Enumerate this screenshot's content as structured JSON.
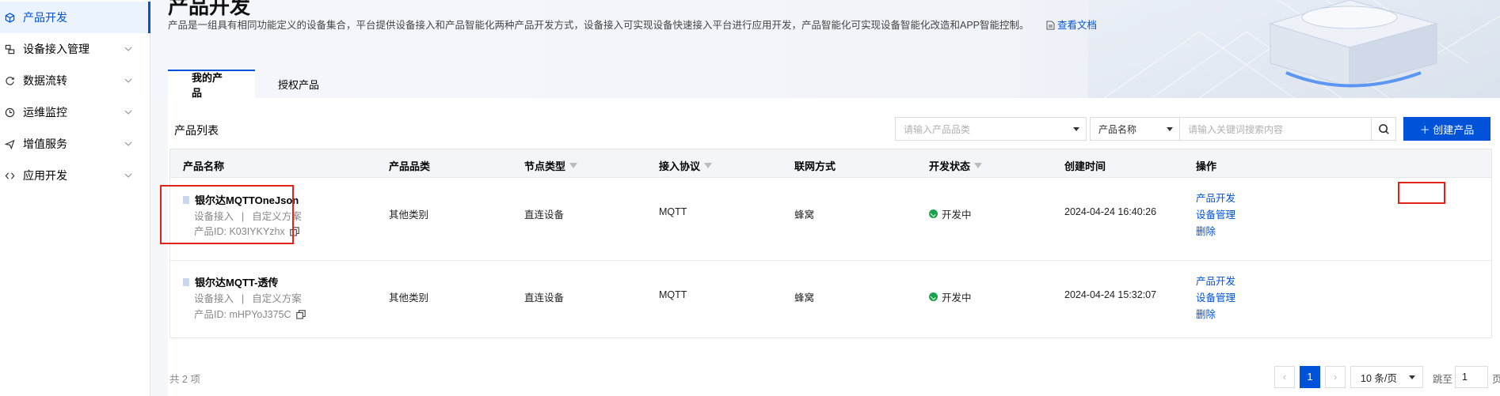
{
  "sidebar": {
    "items": [
      {
        "label": "产品开发",
        "icon": "cube-icon",
        "active": true
      },
      {
        "label": "设备接入管理",
        "icon": "device-icon"
      },
      {
        "label": "数据流转",
        "icon": "dataflow-icon"
      },
      {
        "label": "运维监控",
        "icon": "monitor-icon"
      },
      {
        "label": "增值服务",
        "icon": "send-icon"
      },
      {
        "label": "应用开发",
        "icon": "code-icon"
      }
    ]
  },
  "header": {
    "title": "产品开发",
    "description": "产品是一组具有相同功能定义的设备集合，平台提供设备接入和产品智能化两种产品开发方式，设备接入可实现设备快速接入平台进行应用开发，产品智能化可实现设备智能化改造和APP智能控制。",
    "doc_link": "查看文档"
  },
  "tabs": [
    {
      "label": "我的产品",
      "active": true
    },
    {
      "label": "授权产品"
    }
  ],
  "list": {
    "title": "产品列表",
    "category_placeholder": "请输入产品品类",
    "field_select": "产品名称",
    "keyword_placeholder": "请输入关键词搜索内容",
    "create_button": "＋ 创建产品"
  },
  "table": {
    "columns": {
      "name": "产品名称",
      "category": "产品品类",
      "node_type": "节点类型",
      "protocol": "接入协议",
      "network": "联网方式",
      "status": "开发状态",
      "created": "创建时间",
      "actions": "操作"
    },
    "rows": [
      {
        "name": "银尔达MQTTOneJson",
        "access": "设备接入",
        "scheme": "自定义方案",
        "id_label": "产品ID:",
        "id": "K03IYKYzhx",
        "category": "其他类别",
        "node_type": "直连设备",
        "protocol": "MQTT",
        "network": "蜂窝",
        "status": "开发中",
        "created": "2024-04-24 16:40:26",
        "action_dev": "产品开发",
        "action_device": "设备管理",
        "action_delete": "删除"
      },
      {
        "name": "银尔达MQTT-透传",
        "access": "设备接入",
        "scheme": "自定义方案",
        "id_label": "产品ID:",
        "id": "mHPYoJ375C",
        "category": "其他类别",
        "node_type": "直连设备",
        "protocol": "MQTT",
        "network": "蜂窝",
        "status": "开发中",
        "created": "2024-04-24 15:32:07",
        "action_dev": "产品开发",
        "action_device": "设备管理",
        "action_delete": "删除"
      }
    ]
  },
  "pagination": {
    "total": "共 2 项",
    "prev": "‹",
    "current": "1",
    "next": "›",
    "page_size": "10 条/页",
    "jump_label": "跳至",
    "jump_value": "1",
    "page_suffix": "页"
  },
  "colors": {
    "accent": "#0052d9",
    "status_green": "#16a34a",
    "highlight_red": "#e2231a"
  }
}
